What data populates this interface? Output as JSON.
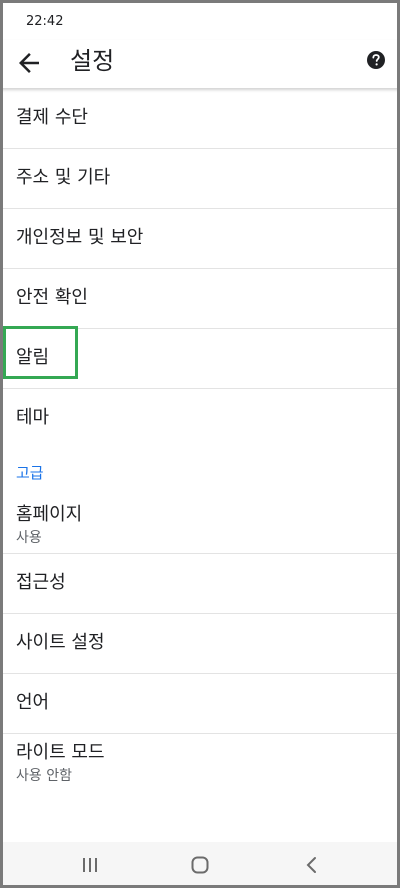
{
  "status_bar": {
    "time": "22:42"
  },
  "app_bar": {
    "title": "설정",
    "back_icon": "arrow-back-icon",
    "help_icon": "help-icon"
  },
  "settings": {
    "items": [
      {
        "label": "결제 수단"
      },
      {
        "label": "주소 및 기타"
      },
      {
        "label": "개인정보 및 보안"
      },
      {
        "label": "안전 확인"
      },
      {
        "label": "알림",
        "highlighted": true
      },
      {
        "label": "테마"
      }
    ],
    "advanced_header": "고급",
    "advanced_items": [
      {
        "label": "홈페이지",
        "sub": "사용"
      },
      {
        "label": "접근성"
      },
      {
        "label": "사이트 설정"
      },
      {
        "label": "언어"
      },
      {
        "label": "라이트 모드",
        "sub": "사용 안함"
      }
    ]
  },
  "nav_bar": {
    "recents_icon": "recents-icon",
    "home_icon": "home-icon",
    "back_icon": "back-chevron-icon"
  },
  "colors": {
    "accent": "#1a73e8",
    "highlight": "#34a853",
    "text": "#202124",
    "subtext": "#5f6368"
  }
}
